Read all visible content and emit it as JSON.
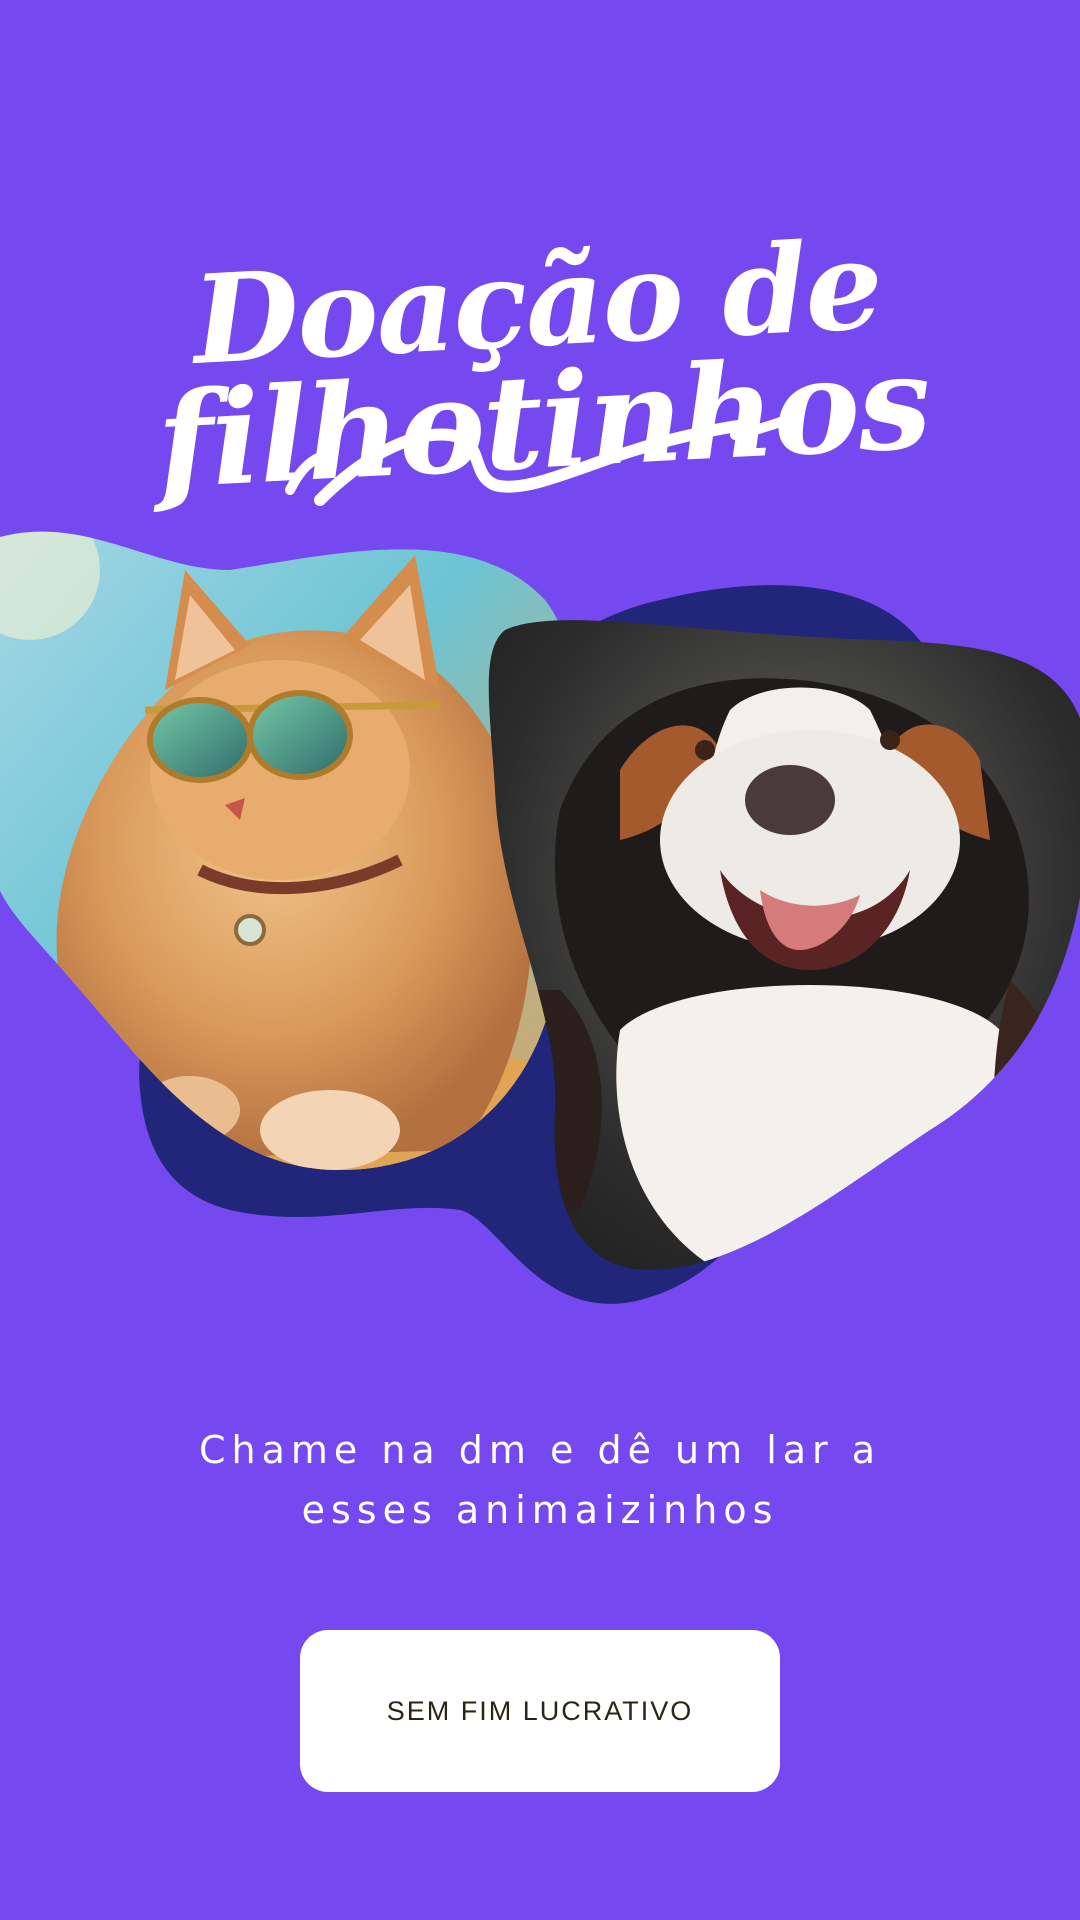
{
  "title": {
    "line1": "Doação de",
    "line2": "filhotinhos"
  },
  "photos": {
    "left_icon": "cat-with-sunglasses",
    "right_icon": "happy-dog"
  },
  "subtitle": {
    "line1": "Chame na dm e dê um lar a",
    "line2": "esses animaizinhos"
  },
  "cta": {
    "label": "SEM FIM LUCRATIVO"
  },
  "colors": {
    "background": "#7649f0",
    "blob": "#21267a",
    "text": "#ffffff",
    "button": "#ffffff",
    "button_text": "#2b2417"
  }
}
